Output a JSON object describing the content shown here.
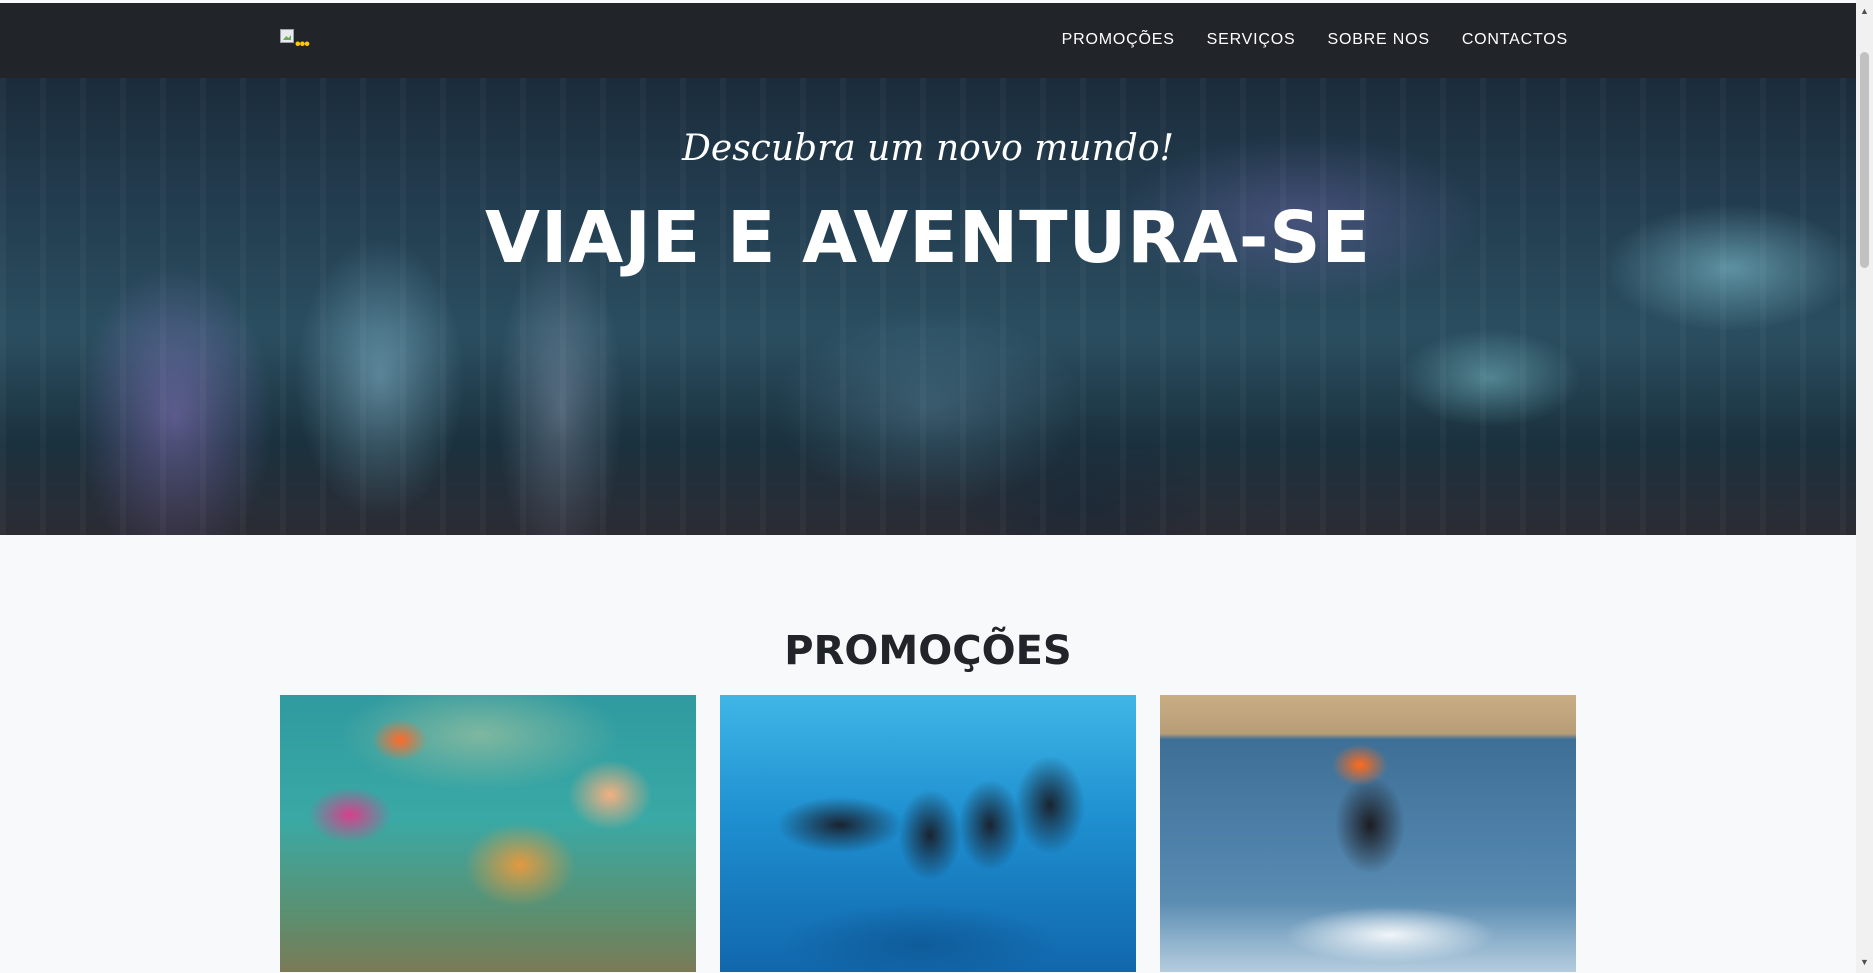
{
  "navbar": {
    "logo_icon": "broken-image-icon",
    "links": [
      {
        "label": "PROMOÇÕES"
      },
      {
        "label": "SERVIÇOS"
      },
      {
        "label": "SOBRE NOS"
      },
      {
        "label": "CONTACTOS"
      }
    ]
  },
  "hero": {
    "subtitle": "Descubra um novo mundo!",
    "title": "VIAJE E AVENTURA-SE"
  },
  "promotions": {
    "title": "PROMOÇÕES",
    "cards": [
      {
        "image": "snorkeling-kids-fish"
      },
      {
        "image": "scuba-divers-group"
      },
      {
        "image": "wakeboarding-kid"
      }
    ]
  },
  "colors": {
    "navbar_bg": "#212529",
    "page_bg": "#f8f9fa",
    "accent": "#ffc800",
    "title_text": "#212529"
  }
}
